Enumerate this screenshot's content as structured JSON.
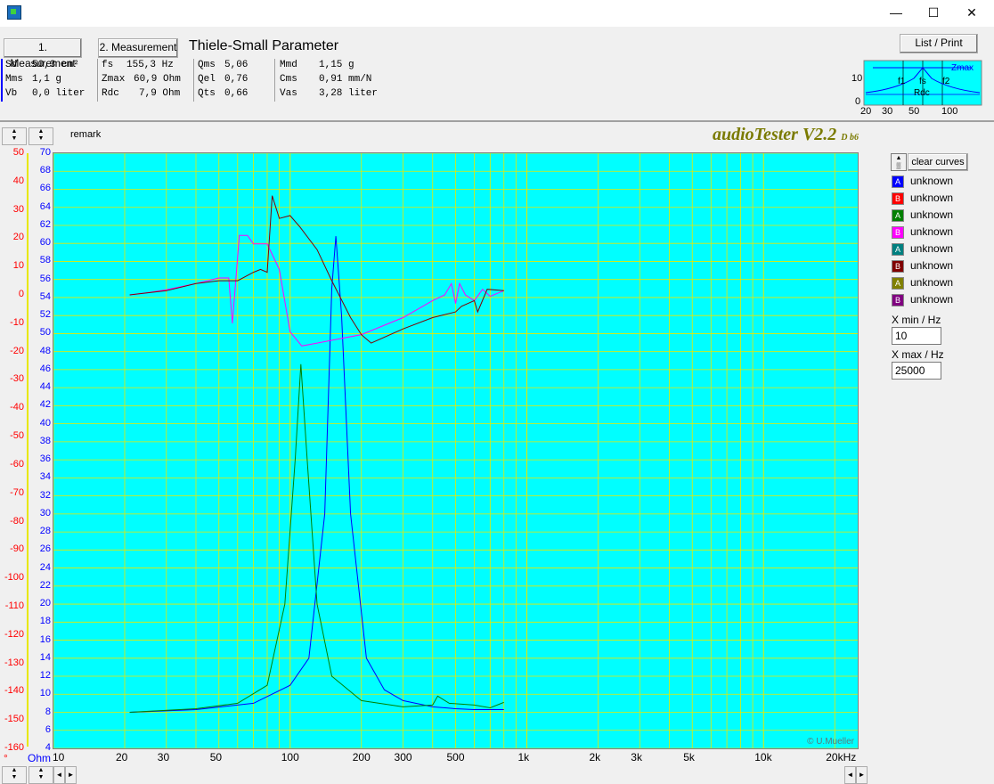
{
  "window": {
    "minimize": "—",
    "maximize": "☐",
    "close": "✕"
  },
  "toolbar": {
    "meas1": "1. Measurement",
    "meas2": "2. Measurement",
    "tsp_title": "Thiele-Small Parameter",
    "list_print": "List / Print"
  },
  "params": {
    "col1": [
      [
        "Sd",
        "50,3 cm²"
      ],
      [
        "Mms",
        "1,1 g"
      ],
      [
        "Vb",
        "0,0 liter"
      ]
    ],
    "col2": [
      [
        "fs",
        "155,3 Hz"
      ],
      [
        "Zmax",
        "60,9 Ohm"
      ],
      [
        "Rdc",
        "7,9 Ohm"
      ]
    ],
    "col3": [
      [
        "Qms",
        "5,06"
      ],
      [
        "Qel",
        "0,76"
      ],
      [
        "Qts",
        "0,66"
      ]
    ],
    "col4": [
      [
        "Mmd",
        "1,15 g"
      ],
      [
        "Cms",
        "0,91 mm/N"
      ],
      [
        "Vas",
        "3,28 liter"
      ]
    ]
  },
  "mini_chart": {
    "labels": [
      "Zmax",
      "f1",
      "fs",
      "f2",
      "Rdc"
    ],
    "y_ticks": [
      "10",
      "0"
    ],
    "x_ticks": [
      "20",
      "30",
      "50",
      "100"
    ]
  },
  "remark": "remark",
  "brand": {
    "name": "audioTester V2.2",
    "suffix": "D b6"
  },
  "copyright": "© U.Mueller",
  "axes": {
    "left_ticks": [
      "50",
      "40",
      "30",
      "20",
      "10",
      "0",
      "-10",
      "-20",
      "-30",
      "-40",
      "-50",
      "-60",
      "-70",
      "-80",
      "-90",
      "-100",
      "-110",
      "-120",
      "-130",
      "-140",
      "-150",
      "-160"
    ],
    "right_ticks": [
      "70",
      "68",
      "66",
      "64",
      "62",
      "60",
      "58",
      "56",
      "54",
      "52",
      "50",
      "48",
      "46",
      "44",
      "42",
      "40",
      "38",
      "36",
      "34",
      "32",
      "30",
      "28",
      "26",
      "24",
      "22",
      "20",
      "18",
      "16",
      "14",
      "12",
      "10",
      "8",
      "6",
      "4"
    ],
    "ohm_label": "Ohm",
    "deg_label": "°",
    "x_ticks": [
      {
        "label": "10",
        "f": 10
      },
      {
        "label": "20",
        "f": 20
      },
      {
        "label": "30",
        "f": 30
      },
      {
        "label": "50",
        "f": 50
      },
      {
        "label": "100",
        "f": 100
      },
      {
        "label": "200",
        "f": 200
      },
      {
        "label": "300",
        "f": 300
      },
      {
        "label": "500",
        "f": 500
      },
      {
        "label": "1k",
        "f": 1000
      },
      {
        "label": "2k",
        "f": 2000
      },
      {
        "label": "3k",
        "f": 3000
      },
      {
        "label": "5k",
        "f": 5000
      },
      {
        "label": "10k",
        "f": 10000
      },
      {
        "label": "20kHz",
        "f": 20000
      }
    ],
    "colors": {
      "left": "#ff0000",
      "right": "#0000ff",
      "grid": "#e8e800"
    }
  },
  "legend": {
    "clear_label": "clear curves",
    "items": [
      {
        "letter": "A",
        "color": "#0000ff",
        "label": "unknown"
      },
      {
        "letter": "B",
        "color": "#ff0000",
        "label": "unknown"
      },
      {
        "letter": "A",
        "color": "#008000",
        "label": "unknown"
      },
      {
        "letter": "B",
        "color": "#ff00ff",
        "label": "unknown"
      },
      {
        "letter": "A",
        "color": "#008080",
        "label": "unknown"
      },
      {
        "letter": "B",
        "color": "#800000",
        "label": "unknown"
      },
      {
        "letter": "A",
        "color": "#808000",
        "label": "unknown"
      },
      {
        "letter": "B",
        "color": "#800080",
        "label": "unknown"
      }
    ],
    "xmin_label": "X min / Hz",
    "xmin_value": "10",
    "xmax_label": "X max / Hz",
    "xmax_value": "25000"
  },
  "chart_data": {
    "type": "line",
    "xlim": [
      10,
      25000
    ],
    "x_scale": "log",
    "ylim_left": [
      -160,
      50
    ],
    "ylim_right": [
      4,
      70
    ],
    "xlabel": "",
    "ylabel_left": "°",
    "ylabel_right": "Ohm",
    "grid": true,
    "series": [
      {
        "color": "#0000ff",
        "axis": "right",
        "points": [
          [
            21,
            8
          ],
          [
            40,
            8.3
          ],
          [
            70,
            9
          ],
          [
            100,
            11
          ],
          [
            120,
            14
          ],
          [
            140,
            30
          ],
          [
            150,
            55
          ],
          [
            156,
            60.8
          ],
          [
            165,
            52
          ],
          [
            180,
            30
          ],
          [
            210,
            14
          ],
          [
            250,
            10.5
          ],
          [
            300,
            9.3
          ],
          [
            400,
            8.6
          ],
          [
            500,
            8.4
          ],
          [
            600,
            8.3
          ],
          [
            800,
            8.3
          ]
        ]
      },
      {
        "color": "#008000",
        "axis": "right",
        "points": [
          [
            21,
            8
          ],
          [
            40,
            8.4
          ],
          [
            60,
            9
          ],
          [
            80,
            11
          ],
          [
            95,
            20
          ],
          [
            105,
            36
          ],
          [
            111,
            46.6
          ],
          [
            118,
            36
          ],
          [
            130,
            20
          ],
          [
            150,
            12
          ],
          [
            200,
            9.3
          ],
          [
            300,
            8.6
          ],
          [
            400,
            8.8
          ],
          [
            420,
            9.8
          ],
          [
            470,
            9.0
          ],
          [
            600,
            8.8
          ],
          [
            700,
            8.5
          ],
          [
            800,
            9.1
          ]
        ]
      },
      {
        "color": "#ff00ff",
        "axis": "left",
        "points": [
          [
            21,
            0
          ],
          [
            25,
            0.8
          ],
          [
            30,
            1.8
          ],
          [
            40,
            4
          ],
          [
            50,
            6
          ],
          [
            55,
            6
          ],
          [
            57,
            -10
          ],
          [
            61,
            21
          ],
          [
            66,
            21
          ],
          [
            70,
            18
          ],
          [
            80,
            18
          ],
          [
            90,
            9
          ],
          [
            100,
            -13
          ],
          [
            112,
            -18
          ],
          [
            130,
            -17
          ],
          [
            200,
            -14
          ],
          [
            300,
            -8
          ],
          [
            400,
            -2
          ],
          [
            450,
            0
          ],
          [
            480,
            4
          ],
          [
            500,
            -3
          ],
          [
            520,
            4
          ],
          [
            550,
            0
          ],
          [
            600,
            -2
          ],
          [
            650,
            2
          ],
          [
            700,
            -0.5
          ],
          [
            800,
            1.5
          ]
        ]
      },
      {
        "color": "#800000",
        "axis": "left",
        "points": [
          [
            21,
            0
          ],
          [
            30,
            1.5
          ],
          [
            40,
            4
          ],
          [
            50,
            5
          ],
          [
            55,
            5
          ],
          [
            60,
            5
          ],
          [
            70,
            8
          ],
          [
            75,
            9
          ],
          [
            80,
            8
          ],
          [
            84,
            35
          ],
          [
            90,
            27
          ],
          [
            100,
            28
          ],
          [
            110,
            24
          ],
          [
            130,
            16
          ],
          [
            150,
            5
          ],
          [
            180,
            -8
          ],
          [
            200,
            -14
          ],
          [
            220,
            -17
          ],
          [
            300,
            -12
          ],
          [
            400,
            -8
          ],
          [
            500,
            -6
          ],
          [
            530,
            -4
          ],
          [
            600,
            -2
          ],
          [
            620,
            -6
          ],
          [
            680,
            2
          ],
          [
            800,
            1.5
          ]
        ]
      }
    ]
  }
}
